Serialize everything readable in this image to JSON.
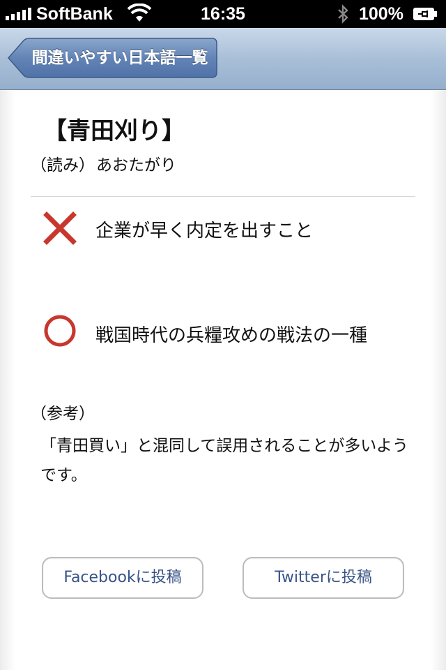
{
  "status_bar": {
    "carrier": "SoftBank",
    "time": "16:35",
    "battery": "100%"
  },
  "nav": {
    "back_label": "間違いやすい日本語一覧"
  },
  "entry": {
    "title": "【青田刈り】",
    "reading_label": "（読み）",
    "reading": "あおたがり",
    "wrong_meaning": "企業が早く内定を出すこと",
    "correct_meaning": "戦国時代の兵糧攻めの戦法の一種",
    "reference_label": "（参考）",
    "reference_text": "「青田買い」と混同して誤用されることが多いようです。"
  },
  "share": {
    "facebook_label": "Facebookに投稿",
    "twitter_label": "Twitterに投稿"
  },
  "colors": {
    "nav_bar": "#a9bfd8",
    "back_button": "#5a7cae",
    "wrong_icon": "#c8372d",
    "correct_icon": "#c8372d",
    "button_text": "#385487"
  },
  "icons": [
    "signal-icon",
    "wifi-icon",
    "bluetooth-icon",
    "battery-icon",
    "cross-icon",
    "circle-icon"
  ]
}
